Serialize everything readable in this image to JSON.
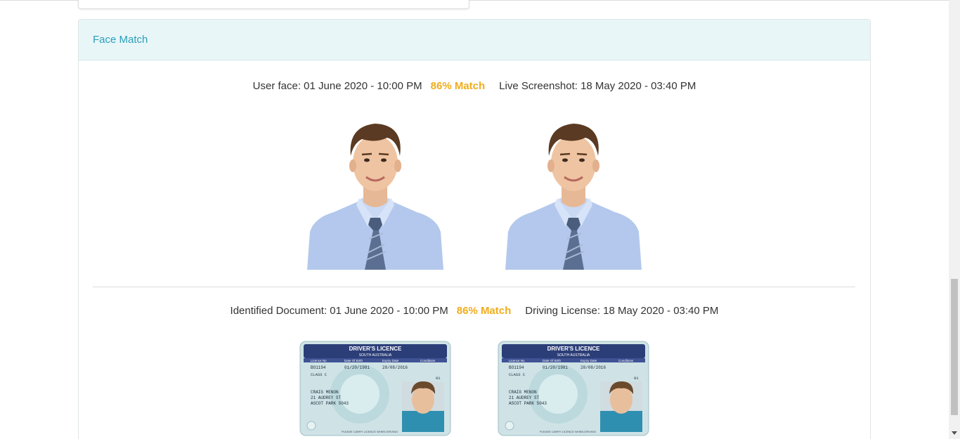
{
  "card": {
    "title": "Face Match"
  },
  "face_row": {
    "user_face": "User face: 01 June 2020 - 10:00 PM",
    "match": "86% Match",
    "live_screenshot": "Live Screenshot: 18 May 2020 - 03:40 PM"
  },
  "document_row": {
    "identified_document": "Identified Document: 01 June 2020 - 10:00 PM",
    "match": "86% Match",
    "driving_license": "Driving License: 18 May 2020 - 03:40 PM"
  },
  "licence_card": {
    "heading": "DRIVER'S LICENCE",
    "state": "SOUTH AUSTRALIA",
    "col_labels": [
      "Licence No",
      "Date Of Birth",
      "Expiry Date",
      "Conditions"
    ],
    "licence_no": "BO1194",
    "dob": "01/20/1981",
    "expiry": "28/08/2016",
    "class": "CLASS C",
    "number_01": "01",
    "name": "CRAIG MENON",
    "address_line1": "21 AUDREY ST",
    "address_line2": "ASCOT PARK 5043",
    "footer": "PLEASE CARRY LICENCE WHEN DRIVING"
  },
  "colors": {
    "accent": "#2a9fb9",
    "match": "#f0ad1c",
    "header_bg": "#e8f6f8"
  }
}
